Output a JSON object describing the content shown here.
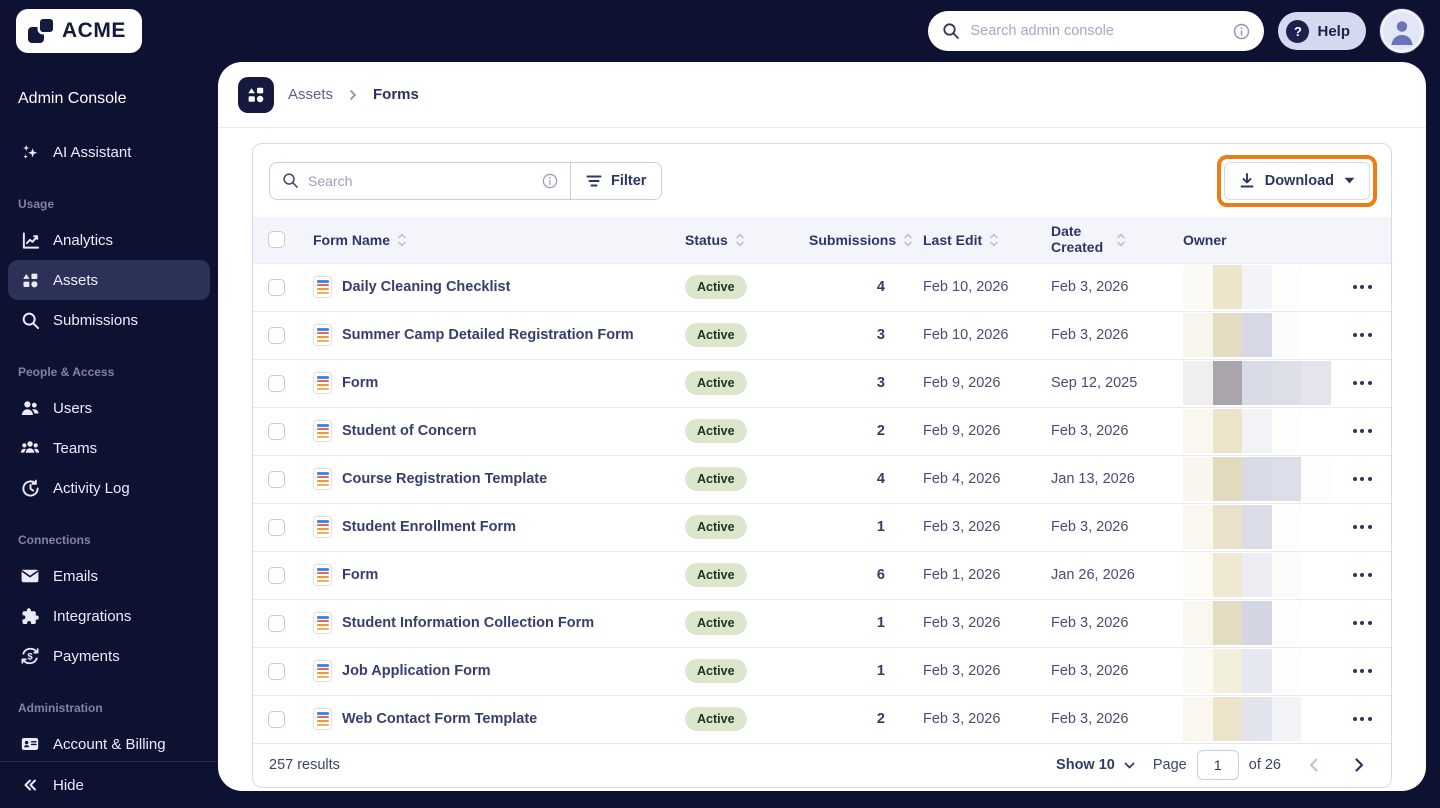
{
  "colors": {
    "navy_bg": "#0d1233",
    "accent_orange": "#ee7b14",
    "status_green_bg": "#dbe7cd",
    "active_nav_bg": "#2b3157",
    "header_row_bg": "#f4f5fb",
    "form_icon_stripes": [
      "#4e82e3",
      "#e9654b",
      "#f0953d",
      "#f3b54e"
    ]
  },
  "topbar": {
    "brand": "ACME",
    "search_placeholder": "Search admin console",
    "help_label": "Help"
  },
  "sidebar": {
    "title": "Admin Console",
    "assistant_label": "AI Assistant",
    "sections": [
      {
        "label": "Usage",
        "items": [
          {
            "label": "Analytics",
            "icon": "analytics-icon",
            "active": false
          },
          {
            "label": "Assets",
            "icon": "assets-icon",
            "active": true
          },
          {
            "label": "Submissions",
            "icon": "search-icon",
            "active": false
          }
        ]
      },
      {
        "label": "People & Access",
        "items": [
          {
            "label": "Users",
            "icon": "users-icon",
            "active": false
          },
          {
            "label": "Teams",
            "icon": "teams-icon",
            "active": false
          },
          {
            "label": "Activity Log",
            "icon": "activity-log-icon",
            "active": false
          }
        ]
      },
      {
        "label": "Connections",
        "items": [
          {
            "label": "Emails",
            "icon": "email-icon",
            "active": false
          },
          {
            "label": "Integrations",
            "icon": "puzzle-icon",
            "active": false
          },
          {
            "label": "Payments",
            "icon": "payments-icon",
            "active": false
          }
        ]
      },
      {
        "label": "Administration",
        "items": [
          {
            "label": "Account & Billing",
            "icon": "billing-icon",
            "active": false
          }
        ]
      }
    ],
    "hide_label": "Hide"
  },
  "breadcrumb": {
    "parent": "Assets",
    "current": "Forms"
  },
  "toolbar": {
    "search_placeholder": "Search",
    "filter_label": "Filter",
    "download_label": "Download"
  },
  "table": {
    "columns": [
      {
        "label": "Form Name",
        "sortable": true
      },
      {
        "label": "Status",
        "sortable": true
      },
      {
        "label": "Submissions",
        "sortable": true
      },
      {
        "label": "Last Edit",
        "sortable": true
      },
      {
        "label": "Date Created",
        "sortable": true
      },
      {
        "label": "Owner",
        "sortable": false
      }
    ],
    "rows": [
      {
        "name": "Daily Cleaning Checklist",
        "status": "Active",
        "submissions": "4",
        "last_edit": "Feb 10, 2026",
        "date_created": "Feb 3, 2026",
        "owner_blur": [
          "#fbfaf4",
          "#ece4cb",
          "#f3f4f8",
          "#fdfdfb",
          "#ffffff"
        ]
      },
      {
        "name": "Summer Camp Detailed Registration Form",
        "status": "Active",
        "submissions": "3",
        "last_edit": "Feb 10, 2026",
        "date_created": "Feb 3, 2026",
        "owner_blur": [
          "#f7f5ec",
          "#e5ddc3",
          "#d6d8e5",
          "#fcfcfa",
          "#ffffff"
        ]
      },
      {
        "name": "Form",
        "status": "Active",
        "submissions": "3",
        "last_edit": "Feb 9, 2026",
        "date_created": "Sep 12, 2025",
        "owner_blur": [
          "#efefed",
          "#aaa5ab",
          "#d9dbe6",
          "#dcdee8",
          "#e3e4ec"
        ]
      },
      {
        "name": "Student of Concern",
        "status": "Active",
        "submissions": "2",
        "last_edit": "Feb 9, 2026",
        "date_created": "Feb 3, 2026",
        "owner_blur": [
          "#f9f7ef",
          "#ebe4cb",
          "#f2f3f7",
          "#fdfdfb",
          "#ffffff"
        ]
      },
      {
        "name": "Course Registration Template",
        "status": "Active",
        "submissions": "4",
        "last_edit": "Feb 4, 2026",
        "date_created": "Jan 13, 2026",
        "owner_blur": [
          "#f8f6ee",
          "#e2dabf",
          "#d8dae6",
          "#dcdee9",
          "#fdfdfd"
        ]
      },
      {
        "name": "Student Enrollment Form",
        "status": "Active",
        "submissions": "1",
        "last_edit": "Feb 3, 2026",
        "date_created": "Feb 3, 2026",
        "owner_blur": [
          "#f9f7f0",
          "#e9e1c9",
          "#dadce7",
          "#fdfdfb",
          "#ffffff"
        ]
      },
      {
        "name": "Form",
        "status": "Active",
        "submissions": "6",
        "last_edit": "Feb 1, 2026",
        "date_created": "Jan 26, 2026",
        "owner_blur": [
          "#fcfbf6",
          "#efe9d4",
          "#eceef4",
          "#fbfbfa",
          "#ffffff"
        ]
      },
      {
        "name": "Student Information Collection Form",
        "status": "Active",
        "submissions": "1",
        "last_edit": "Feb 3, 2026",
        "date_created": "Feb 3, 2026",
        "owner_blur": [
          "#f9f7ef",
          "#e4dcc2",
          "#d3d5e3",
          "#fdfdfb",
          "#ffffff"
        ]
      },
      {
        "name": "Job Application Form",
        "status": "Active",
        "submissions": "1",
        "last_edit": "Feb 3, 2026",
        "date_created": "Feb 3, 2026",
        "owner_blur": [
          "#fbfaf5",
          "#f3efdd",
          "#e6e8f0",
          "#fdfdfb",
          "#ffffff"
        ]
      },
      {
        "name": "Web Contact Form Template",
        "status": "Active",
        "submissions": "2",
        "last_edit": "Feb 3, 2026",
        "date_created": "Feb 3, 2026",
        "owner_blur": [
          "#f9f7ef",
          "#ebe4cb",
          "#e1e3ed",
          "#f2f3f7",
          "#ffffff"
        ]
      }
    ]
  },
  "footer": {
    "results": "257 results",
    "show_label": "Show 10",
    "page_label": "Page",
    "page_value": "1",
    "of_label": "of 26"
  }
}
